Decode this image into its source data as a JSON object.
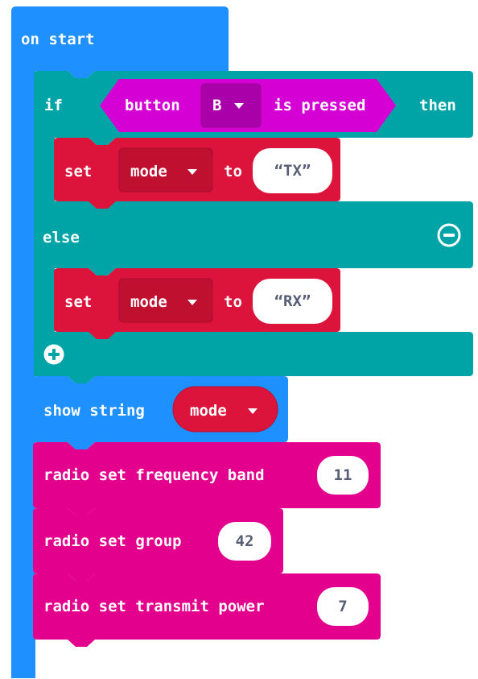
{
  "on_start": {
    "label": "on start"
  },
  "if_block": {
    "if_label": "if",
    "then_label": "then",
    "else_label": "else",
    "condition": {
      "button_label": "button",
      "button_value": "B",
      "suffix_label": "is pressed"
    },
    "then_body": {
      "set_label": "set",
      "variable": "mode",
      "to_label": "to",
      "value": "TX"
    },
    "else_body": {
      "set_label": "set",
      "variable": "mode",
      "to_label": "to",
      "value": "RX"
    },
    "remove_icon": "minus-circle-icon",
    "add_icon": "plus-circle-icon"
  },
  "show_string": {
    "label": "show string",
    "variable": "mode"
  },
  "radio_band": {
    "label": "radio set frequency band",
    "value": "11"
  },
  "radio_group": {
    "label": "radio set group",
    "value": "42"
  },
  "radio_power": {
    "label": "radio set transmit power",
    "value": "7"
  },
  "colors": {
    "basic": "#1e90ff",
    "logic": "#00a4a6",
    "variables": "#dc143c",
    "input": "#d400d4",
    "radio": "#e3008c"
  }
}
